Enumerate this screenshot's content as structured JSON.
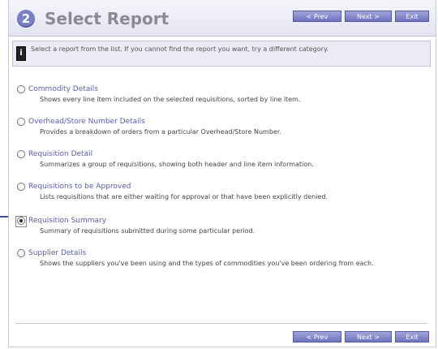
{
  "header": {
    "step_number": "2",
    "title": "Select Report"
  },
  "nav": {
    "prev_label": "< Prev",
    "next_label": "Next >",
    "exit_label": "Exit"
  },
  "info": {
    "icon": "info-icon",
    "text": "Select a report from the list. If you cannot find the report you want, try a different category."
  },
  "options": [
    {
      "label": "Commodity Details",
      "description": "Shows every line item included on the selected requisitions, sorted by line item.",
      "selected": false
    },
    {
      "label": "Overhead/Store Number Details",
      "description": "Provides a breakdown of orders from a particular Overhead/Store Number.",
      "selected": false
    },
    {
      "label": "Requisition Detail",
      "description": "Summarizes a group of requisitions, showing both header and line item information.",
      "selected": false
    },
    {
      "label": "Requisitions to be Approved",
      "description": "Lists requisitions that are either waiting for approval or that have been explicitly denied.",
      "selected": false
    },
    {
      "label": "Requisition Summary",
      "description": "Summary of requisitions submitted during some particular period.",
      "selected": true
    },
    {
      "label": "Supplier Details",
      "description": "Shows the suppliers you've been using and the types of commodities you've been ordering from each.",
      "selected": false
    }
  ],
  "colors": {
    "accent": "#7c80c4",
    "link": "#5a5ea8",
    "pointer": "#3d4fa0"
  }
}
